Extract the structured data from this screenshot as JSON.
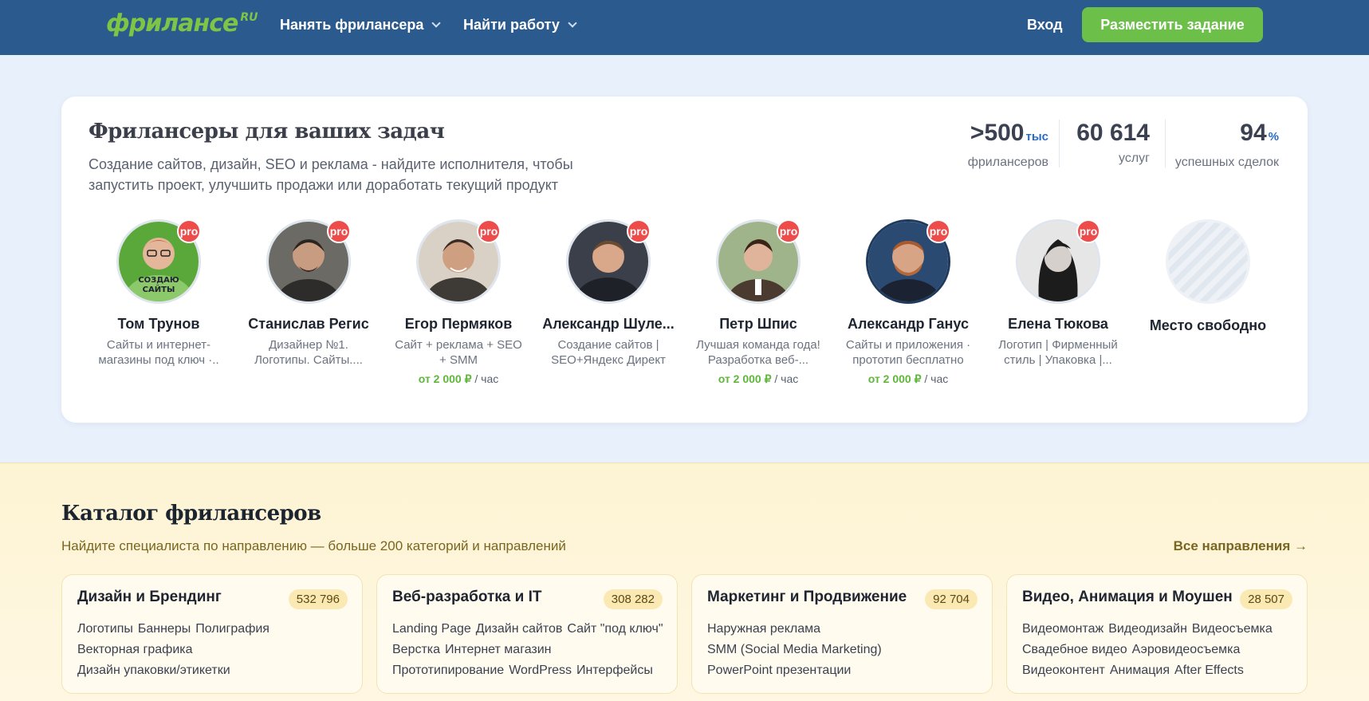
{
  "header": {
    "logo_main": "фрилансе",
    "logo_ru": "RU",
    "nav": [
      {
        "label": "Нанять фрилансера"
      },
      {
        "label": "Найти работу"
      }
    ],
    "login": "Вход",
    "post_task": "Разместить задание"
  },
  "hero": {
    "title": "Фрилансеры для ваших задач",
    "subtitle": "Создание сайтов, дизайн, SEO и реклама - найдите исполнителя, чтобы запустить проект, улучшить продажи или доработать текущий продукт",
    "stats": [
      {
        "value": ">500",
        "unit": "тыс",
        "label": "фрилансеров"
      },
      {
        "value": "60 614",
        "unit": "",
        "label": "услуг"
      },
      {
        "value": "94",
        "unit": "%",
        "label": "успешных сделок"
      }
    ],
    "pro_badge": "pro",
    "rate_suffix": " / час",
    "freelancers": [
      {
        "name": "Том Трунов",
        "desc": "Сайты и интернет-магазины под ключ ·..",
        "rate": "",
        "avatar_color": "#5aa83a",
        "avatar_text": "СОЗДАЮ САЙТЫ"
      },
      {
        "name": "Станислав Регис",
        "desc": "Дизайнер №1. Логотипы. Сайты....",
        "rate": "",
        "avatar_color": "#6b6a64"
      },
      {
        "name": "Егор Пермяков",
        "desc": "Сайт + реклама + SEO + SMM",
        "rate": "от 2 000 ₽",
        "avatar_color": "#c9bfb3"
      },
      {
        "name": "Александр Шуле...",
        "desc": "Создание сайтов | SEO+Яндекс Директ |..",
        "rate": "",
        "avatar_color": "#3a3f4a"
      },
      {
        "name": "Петр Шпис",
        "desc": "Лучшая команда года! Разработка веб-...",
        "rate": "от 2 000 ₽",
        "avatar_color": "#9fb48a"
      },
      {
        "name": "Александр Ганус",
        "desc": "Сайты и приложения · прототип бесплатно",
        "rate": "от 2 000 ₽",
        "avatar_color": "#2b4a72"
      },
      {
        "name": "Елена Тюкова",
        "desc": "Логотип | Фирменный стиль | Упаковка |...",
        "rate": "",
        "avatar_color": "#d8d8d8"
      }
    ],
    "free_slot": "Место свободно"
  },
  "catalog": {
    "title": "Каталог фрилансеров",
    "subtitle": "Найдите специалиста по направлению — больше 200 категорий и направлений",
    "all_link": "Все направления →",
    "categories": [
      {
        "title": "Дизайн и Брендинг",
        "count": "532 796",
        "links": [
          "Логотипы",
          "Баннеры",
          "Полиграфия",
          "Векторная графика",
          "Дизайн упаковки/этикетки"
        ]
      },
      {
        "title": "Веб-разработка и IT",
        "count": "308 282",
        "links": [
          "Landing Page",
          "Дизайн сайтов",
          "Сайт \"под ключ\"",
          "Верстка",
          "Интернет магазин",
          "Прототипирование",
          "WordPress",
          "Интерфейсы"
        ]
      },
      {
        "title": "Маркетинг и Продвижение",
        "count": "92 704",
        "links": [
          "Наружная реклама",
          "SMM (Social Media Marketing)",
          "PowerPoint презентации"
        ]
      },
      {
        "title": "Видео, Анимация и Моушен",
        "count": "28 507",
        "links": [
          "Видеомонтаж",
          "Видеодизайн",
          "Видеосъемка",
          "Свадебное видео",
          "Аэровидеосъемка",
          "Видеоконтент",
          "Анимация",
          "After Effects"
        ]
      }
    ]
  }
}
